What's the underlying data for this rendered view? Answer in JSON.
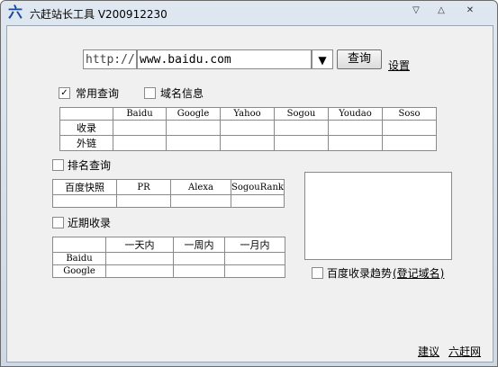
{
  "window": {
    "title": "六赶站长工具 V200912230",
    "icon_glyph": "六",
    "controls": {
      "minimize": "▽",
      "maximize": "△",
      "close": "✕"
    }
  },
  "url_bar": {
    "prefix": "http://",
    "value": "www.baidu.com",
    "dropdown": "▼",
    "query_button": "查询",
    "settings_link": "设置"
  },
  "options": {
    "common_query": {
      "label": "常用查询",
      "checked": true
    },
    "domain_info": {
      "label": "域名信息",
      "checked": false
    }
  },
  "common_table": {
    "columns": [
      "Baidu",
      "Google",
      "Yahoo",
      "Sogou",
      "Youdao",
      "Soso"
    ],
    "rows": [
      "收录",
      "外链"
    ]
  },
  "rank": {
    "label": "排名查询",
    "checked": false,
    "columns": [
      "百度快照",
      "PR",
      "Alexa",
      "SogouRank"
    ]
  },
  "recent": {
    "label": "近期收录",
    "checked": false,
    "columns": [
      "一天内",
      "一周内",
      "一月内"
    ],
    "rows": [
      "Baidu",
      "Google"
    ]
  },
  "trend": {
    "label": "百度收录趋势",
    "link": "(登记域名)",
    "checked": false
  },
  "footer": {
    "suggest": "建议",
    "site": "六赶网"
  },
  "check_mark": "✓"
}
